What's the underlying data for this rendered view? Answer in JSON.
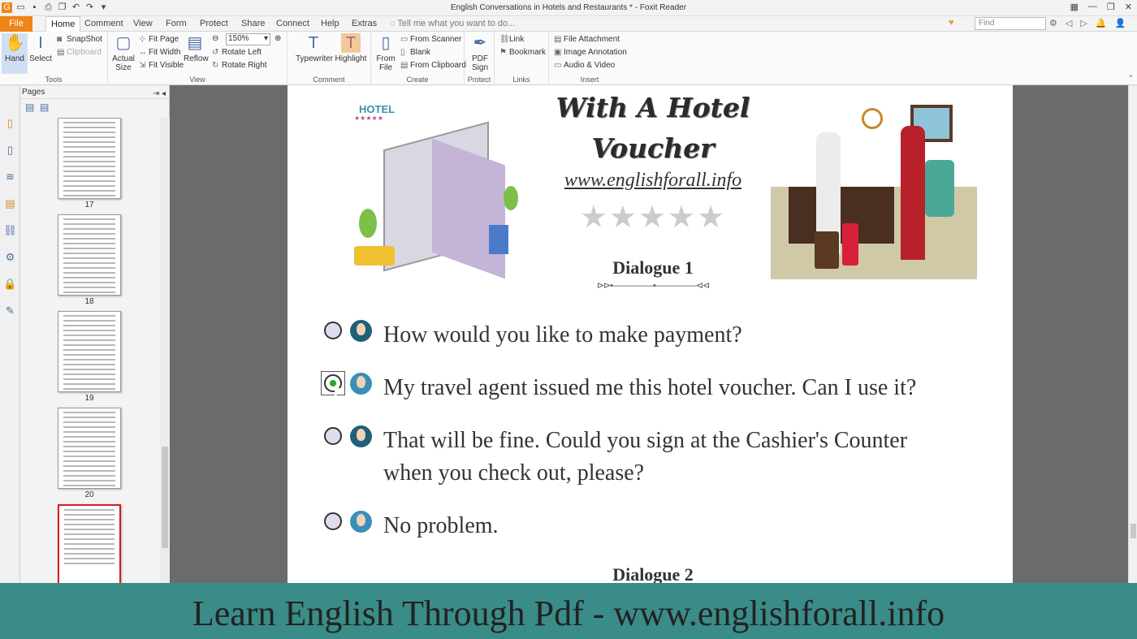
{
  "window": {
    "title": "English Conversations in Hotels and Restaurants * - Foxit Reader"
  },
  "menu": {
    "tabs": [
      "File",
      "Home",
      "Comment",
      "View",
      "Form",
      "Protect",
      "Share",
      "Connect",
      "Help",
      "Extras"
    ],
    "tell_me": "Tell me what you want to do...",
    "find_placeholder": "Find"
  },
  "ribbon": {
    "tools": {
      "label": "Tools",
      "hand": "Hand",
      "select": "Select",
      "snapshot": "SnapShot",
      "clipboard": "Clipboard"
    },
    "view": {
      "label": "View",
      "actual_size": "Actual Size",
      "fit_page": "Fit Page",
      "fit_width": "Fit Width",
      "fit_visible": "Fit Visible",
      "reflow": "Reflow",
      "zoom": "150%",
      "rotate_left": "Rotate Left",
      "rotate_right": "Rotate Right"
    },
    "comment": {
      "label": "Comment",
      "typewriter": "Typewriter",
      "highlight": "Highlight"
    },
    "create": {
      "label": "Create",
      "from_file": "From File",
      "from_scanner": "From Scanner",
      "blank": "Blank",
      "from_clipboard": "From Clipboard"
    },
    "protect": {
      "label": "Protect",
      "pdf_sign": "PDF Sign"
    },
    "links": {
      "label": "Links",
      "link": "Link",
      "bookmark": "Bookmark"
    },
    "insert": {
      "label": "Insert",
      "file_attachment": "File Attachment",
      "image_annotation": "Image Annotation",
      "audio_video": "Audio & Video"
    }
  },
  "pages_panel": {
    "title": "Pages",
    "pages": [
      "17",
      "18",
      "19",
      "20"
    ]
  },
  "document": {
    "title_line1": "With A Hotel",
    "title_line2": "Voucher",
    "hotel_sign": "HOTEL",
    "url": "www.englishforall.info",
    "stars": "★★★★★",
    "dialogue1": "Dialogue 1",
    "dialogue2": "Dialogue 2",
    "ornament": "⊳⊳•—————•—————⊲⊲",
    "lines": [
      {
        "speaker": "man",
        "text": "How would you like to make payment?",
        "checked": false
      },
      {
        "speaker": "woman",
        "text": "My travel agent issued me this hotel voucher. Can I use it?",
        "checked": true
      },
      {
        "speaker": "man",
        "text": "That will be fine. Could you sign at the Cashier's Counter when you check out, please?",
        "checked": false
      },
      {
        "speaker": "woman",
        "text": "No problem.",
        "checked": false
      }
    ]
  },
  "banner": {
    "text": "Learn English Through Pdf - www.englishforall.info"
  },
  "colors": {
    "file_tab": "#f08418",
    "banner": "#3a8c88",
    "radio_checked": "#22aa33"
  }
}
